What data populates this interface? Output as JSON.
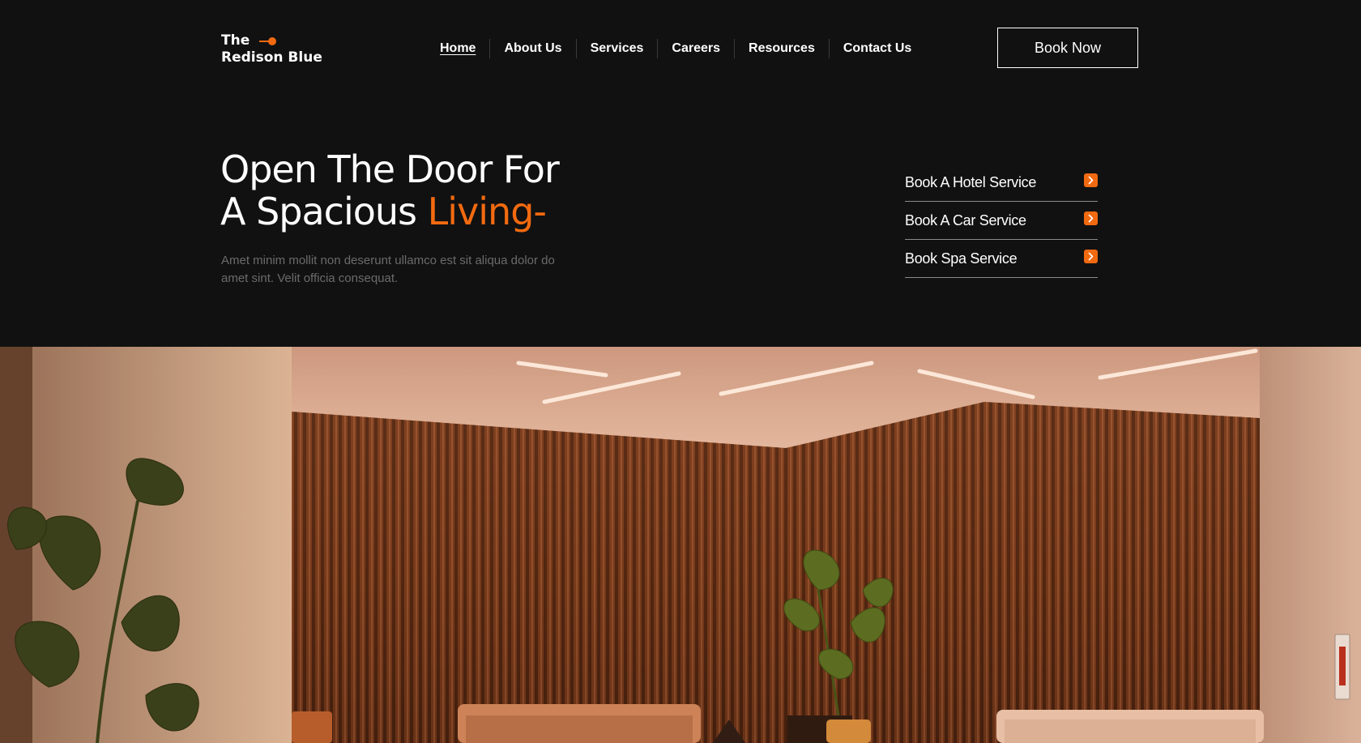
{
  "brand": {
    "line1": "The",
    "line2": "Redison Blue",
    "accent_color": "#f26a10"
  },
  "nav": {
    "items": [
      {
        "label": "Home",
        "active": true
      },
      {
        "label": "About Us"
      },
      {
        "label": "Services"
      },
      {
        "label": "Careers"
      },
      {
        "label": "Resources"
      },
      {
        "label": "Contact Us"
      }
    ]
  },
  "header": {
    "cta_label": "Book Now"
  },
  "hero": {
    "title_line1": "Open The Door For",
    "title_line2_prefix": "A Spacious ",
    "title_line2_accent": "Living-",
    "description": "Amet minim mollit non deserunt ullamco est sit aliqua dolor do amet sint. Velit officia consequat."
  },
  "services": {
    "items": [
      {
        "label": "Book A Hotel Service",
        "icon": "chevron-right-icon"
      },
      {
        "label": "Book A Car Service",
        "icon": "chevron-right-icon"
      },
      {
        "label": "Book Spa Service",
        "icon": "chevron-right-icon"
      }
    ]
  },
  "colors": {
    "background": "#111111",
    "accent": "#f26a10",
    "muted_text": "#6b6b6b"
  }
}
